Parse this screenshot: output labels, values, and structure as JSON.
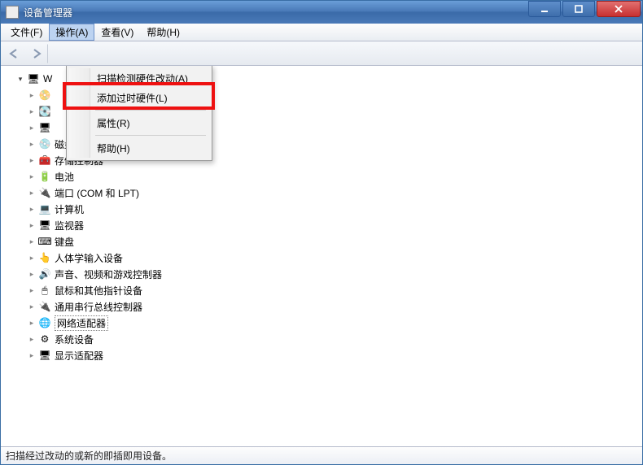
{
  "window": {
    "title": "设备管理器"
  },
  "menubar": {
    "file": "文件(F)",
    "action": "操作(A)",
    "view": "查看(V)",
    "help": "帮助(H)"
  },
  "dropdown": {
    "scan": "扫描检测硬件改动(A)",
    "add_legacy": "添加过时硬件(L)",
    "properties": "属性(R)",
    "help": "帮助(H)"
  },
  "tree": {
    "root": "W",
    "items": [
      {
        "icon": "📀",
        "label": ""
      },
      {
        "icon": "💽",
        "label": ""
      },
      {
        "icon": "🖥",
        "label": ""
      },
      {
        "icon": "💿",
        "label": "磁盘驱动器"
      },
      {
        "icon": "🧰",
        "label": "存储控制器"
      },
      {
        "icon": "🔋",
        "label": "电池"
      },
      {
        "icon": "🔌",
        "label": "端口 (COM 和 LPT)"
      },
      {
        "icon": "💻",
        "label": "计算机"
      },
      {
        "icon": "🖥",
        "label": "监视器"
      },
      {
        "icon": "⌨",
        "label": "键盘"
      },
      {
        "icon": "👆",
        "label": "人体学输入设备"
      },
      {
        "icon": "🔊",
        "label": "声音、视频和游戏控制器"
      },
      {
        "icon": "🖱",
        "label": "鼠标和其他指针设备"
      },
      {
        "icon": "🔌",
        "label": "通用串行总线控制器"
      },
      {
        "icon": "🌐",
        "label": "网络适配器",
        "selected": true
      },
      {
        "icon": "⚙",
        "label": "系统设备"
      },
      {
        "icon": "🖥",
        "label": "显示适配器"
      }
    ]
  },
  "status": "扫描经过改动的或新的即插即用设备。"
}
